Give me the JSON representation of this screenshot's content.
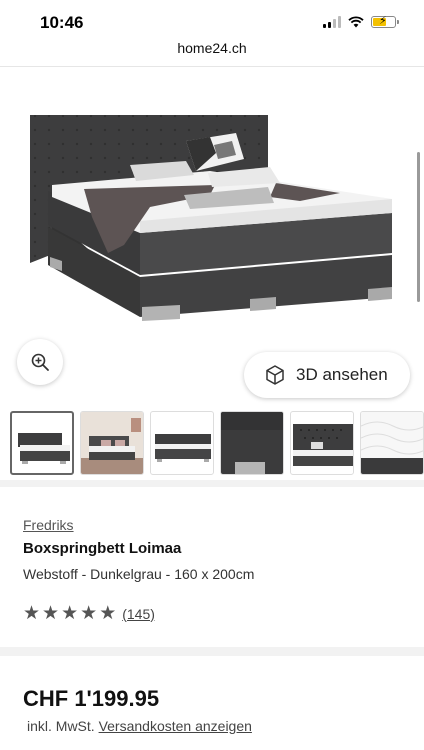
{
  "status_bar": {
    "time": "10:46"
  },
  "browser": {
    "url": "home24.ch"
  },
  "gallery": {
    "view3d_label": "3D ansehen",
    "icons": {
      "zoom": "zoom-in-icon",
      "view3d": "cube-icon"
    }
  },
  "thumbnails": [
    {
      "name": "bed-front-view",
      "active": true
    },
    {
      "name": "bedroom-scene",
      "active": false
    },
    {
      "name": "bed-white-background",
      "active": false
    },
    {
      "name": "bed-foot-detail",
      "active": false
    },
    {
      "name": "headboard-detail",
      "active": false
    },
    {
      "name": "topper-detail",
      "active": false
    }
  ],
  "product": {
    "brand": "Fredriks",
    "title": "Boxspringbett Loimaa",
    "variant": "Webstoff - Dunkelgrau - 160 x 200cm",
    "rating": 5,
    "review_count": "(145)"
  },
  "price": {
    "amount": "CHF 1'199.95",
    "tax_prefix": "inkl. MwSt.",
    "shipping_link": "Versandkosten anzeigen"
  },
  "colors": {
    "bed_fabric": "#3f3f40",
    "accent_text": "#222222",
    "star": "#555555"
  }
}
